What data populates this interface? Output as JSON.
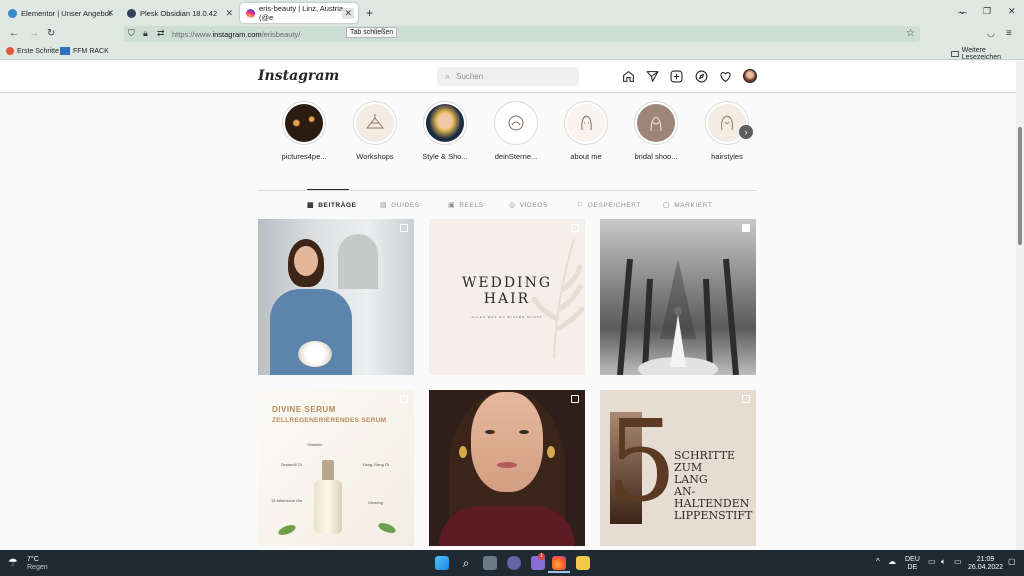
{
  "browser": {
    "tabs": [
      {
        "title": "Elementor | Unser Angebot",
        "active": false
      },
      {
        "title": "Plesk Obsidian 18.0.42",
        "active": false
      },
      {
        "title": "eris-beauty | Linz, Austria (@e",
        "active": true
      }
    ],
    "tooltip": "Tab schließen",
    "url_prefix": "https://www.",
    "url_domain": "instagram.com",
    "url_path": "/erisbeauty/",
    "bookmarks": [
      "Erste Schritte",
      "FFM RACK"
    ],
    "other_bookmarks": "Weitere Lesezeichen"
  },
  "instagram": {
    "logo": "Instagram",
    "search_placeholder": "Suchen",
    "stories": [
      {
        "label": "pictures4pe...",
        "icon": "candles-image"
      },
      {
        "label": "Workshops",
        "icon": "lineart-tools"
      },
      {
        "label": "Style & Sho...",
        "icon": "portrait-photo"
      },
      {
        "label": "deinSterne...",
        "icon": "lineart-logo"
      },
      {
        "label": "about me",
        "icon": "lineart-face"
      },
      {
        "label": "bridal shoo...",
        "icon": "lineart-bride"
      },
      {
        "label": "hairstyles",
        "icon": "lineart-hair"
      }
    ],
    "profile_tabs": [
      {
        "label": "BEITRÄGE",
        "active": true
      },
      {
        "label": "GUIDES",
        "active": false
      },
      {
        "label": "REELS",
        "active": false
      },
      {
        "label": "VIDEOS",
        "active": false
      },
      {
        "label": "GESPEICHERT",
        "active": false
      },
      {
        "label": "MARKIERT",
        "active": false
      }
    ],
    "posts": {
      "wedding_line1": "WEDDING",
      "wedding_line2": "HAIR",
      "wedding_sub": "ALLES WAS DU WISSEN MUSST",
      "serum_title": "DIVINE SERUM",
      "serum_sub": "ZELLREGENERIERENDES SERUM",
      "serum_ingredients": [
        "Vitamine",
        "Sesamöl Öl",
        "Ylang-Ylang Öl",
        "15 ätherische Öle",
        "Ginseng"
      ],
      "five_number": "5",
      "five_lines": [
        "SCHRITTE",
        "ZUM",
        "LANG",
        "AN-",
        "HALTENDEN",
        "LIPPENSTIFT"
      ]
    }
  },
  "taskbar": {
    "temperature": "7°C",
    "weather": "Regen",
    "lang_top": "DEU",
    "lang_bottom": "DE",
    "time": "21:09",
    "date": "26.04.2022",
    "badge": "1"
  },
  "colors": {
    "chrome_bg": "#dfe7e3",
    "taskbar": "#1f2a33",
    "serum_gold": "#b8895a",
    "five_brown": "#5a3a22"
  }
}
